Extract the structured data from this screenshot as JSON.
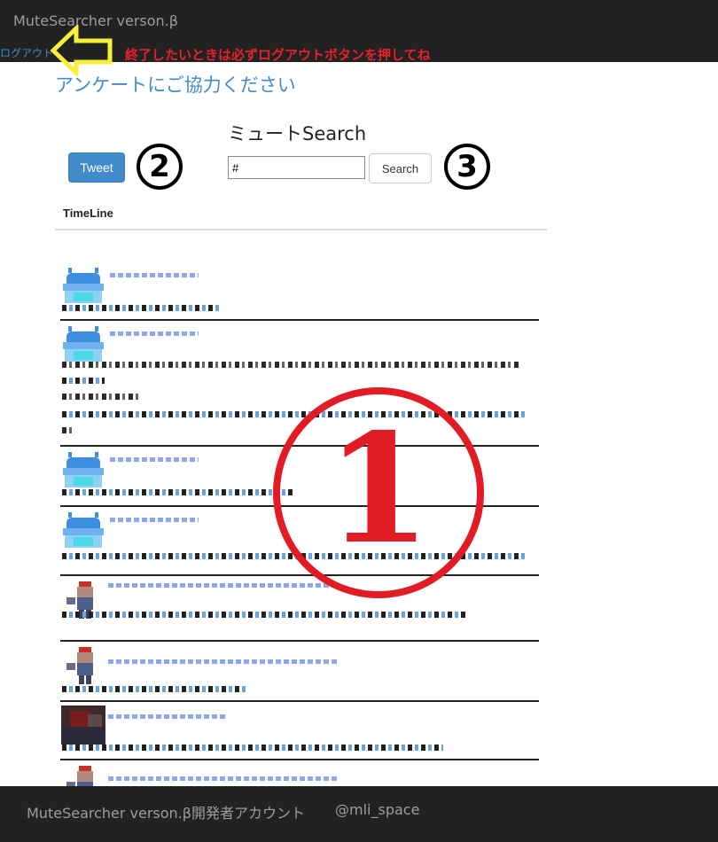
{
  "navbar": {
    "brand": "MuteSearcher verson.β",
    "logout_label": "ログアウト"
  },
  "annotations": {
    "logout_note": "終了したいときは必ずログアウトボタンを押してね",
    "marker_1": "1",
    "marker_2": "2",
    "marker_3": "3",
    "note_color": "#e8202a",
    "arrow_color": "#f7ef3a"
  },
  "survey_link": "アンケートにご協力ください",
  "tweet_button": {
    "label": "Tweet"
  },
  "search": {
    "title": "ミュートSearch",
    "input_value": "#",
    "button_label": "Search"
  },
  "timeline": {
    "label": "TimeLine",
    "items": [
      {
        "avatar": "robot-avatar",
        "lines": 1
      },
      {
        "avatar": "robot-avatar",
        "lines": 4
      },
      {
        "avatar": "robot-avatar",
        "lines": 1
      },
      {
        "avatar": "robot-avatar",
        "lines": 1
      },
      {
        "avatar": "character-avatar",
        "lines": 1
      },
      {
        "avatar": "character-avatar",
        "lines": 1
      },
      {
        "avatar": "dark-photo-avatar",
        "lines": 1
      },
      {
        "avatar": "character-avatar",
        "lines": 0
      }
    ]
  },
  "footer": {
    "text": "MuteSearcher verson.β開発者アカウント",
    "account": "@mli_space"
  },
  "colors": {
    "navbar_bg": "#222222",
    "link_blue": "#428bca",
    "primary_button": "#428bca"
  }
}
